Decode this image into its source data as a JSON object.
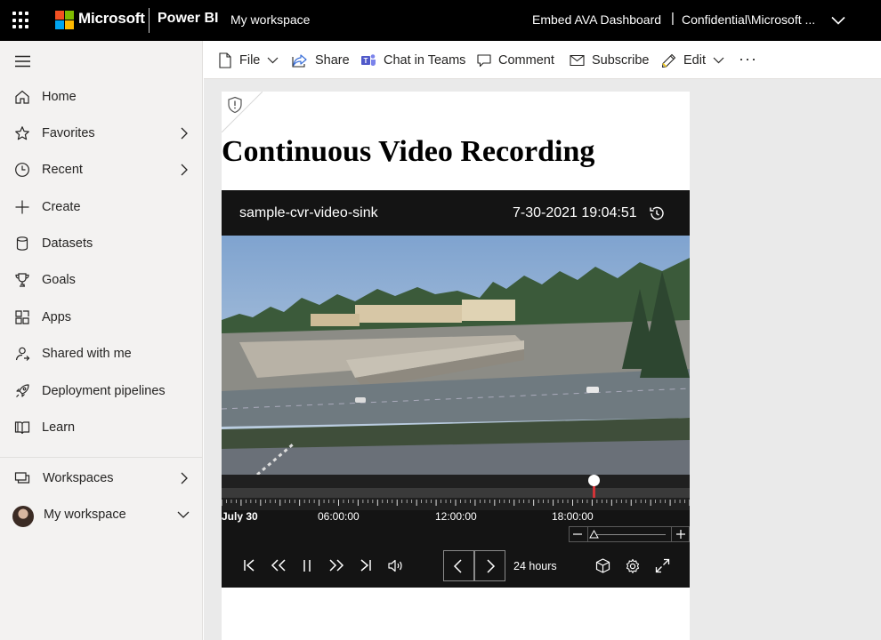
{
  "topbar": {
    "brand": "Microsoft",
    "product": "Power BI",
    "workspace": "My workspace",
    "report_name": "Embed AVA Dashboard",
    "separator": "|",
    "sensitivity": "Confidential\\Microsoft ..."
  },
  "sidebar": {
    "items": [
      {
        "label": "Home",
        "icon": "home-icon"
      },
      {
        "label": "Favorites",
        "icon": "star-icon"
      },
      {
        "label": "Recent",
        "icon": "clock-icon"
      },
      {
        "label": "Create",
        "icon": "plus-icon"
      },
      {
        "label": "Datasets",
        "icon": "database-icon"
      },
      {
        "label": "Goals",
        "icon": "trophy-icon"
      },
      {
        "label": "Apps",
        "icon": "apps-icon"
      },
      {
        "label": "Shared with me",
        "icon": "shared-icon"
      },
      {
        "label": "Deployment pipelines",
        "icon": "rocket-icon"
      },
      {
        "label": "Learn",
        "icon": "book-icon"
      }
    ],
    "workspaces": "Workspaces",
    "my_workspace": "My workspace"
  },
  "toolbar": {
    "file": "File",
    "share": "Share",
    "chat": "Chat in Teams",
    "comment": "Comment",
    "subscribe": "Subscribe",
    "edit": "Edit",
    "more": "···"
  },
  "report": {
    "title": "Continuous Video Recording"
  },
  "player": {
    "video_name": "sample-cvr-video-sink",
    "timestamp": "7-30-2021 19:04:51",
    "timeline_labels": [
      "July 30",
      "06:00:00",
      "12:00:00",
      "18:00:00"
    ],
    "time_range": "24 hours",
    "playhead_fraction": 0.794
  },
  "colors": {
    "ms_red": "#f25022",
    "ms_green": "#7fba00",
    "ms_blue": "#00a4ef",
    "ms_yellow": "#ffb900",
    "playhead": "#d13438"
  }
}
